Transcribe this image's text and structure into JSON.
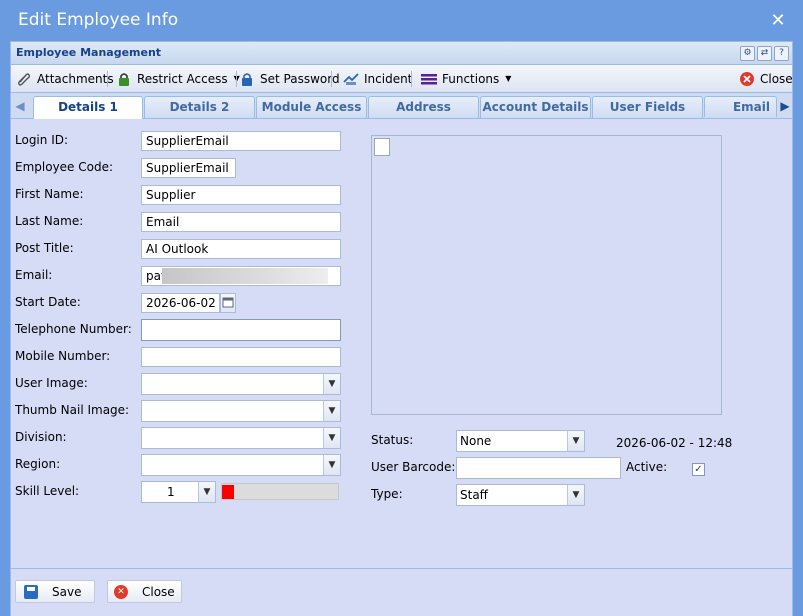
{
  "window": {
    "title": "Edit Employee Info"
  },
  "panel": {
    "title": "Employee Management"
  },
  "toolbar": {
    "attachments": "Attachments",
    "restrict_access": "Restrict Access",
    "set_password": "Set Password",
    "incident": "Incident",
    "functions": "Functions",
    "close": "Close"
  },
  "tabs": [
    "Details 1",
    "Details 2",
    "Module Access",
    "Address",
    "Account Details",
    "User Fields",
    "Email"
  ],
  "form": {
    "login_id": {
      "label": "Login ID:",
      "value": "SupplierEmail"
    },
    "employee_code": {
      "label": "Employee Code:",
      "value": "SupplierEmail"
    },
    "first_name": {
      "label": "First Name:",
      "value": "Supplier"
    },
    "last_name": {
      "label": "Last Name:",
      "value": "Email"
    },
    "post_title": {
      "label": "Post Title:",
      "value": "AI Outlook"
    },
    "email": {
      "label": "Email:",
      "value": "pay"
    },
    "start_date": {
      "label": "Start Date:",
      "value": "2026-06-02"
    },
    "telephone": {
      "label": "Telephone Number:",
      "value": ""
    },
    "mobile": {
      "label": "Mobile Number:",
      "value": ""
    },
    "user_image": {
      "label": "User Image:",
      "value": ""
    },
    "thumb_image": {
      "label": "Thumb Nail Image:",
      "value": ""
    },
    "division": {
      "label": "Division:",
      "value": ""
    },
    "region": {
      "label": "Region:",
      "value": ""
    },
    "skill_level": {
      "label": "Skill Level:",
      "value": "1",
      "fill": 0.1
    }
  },
  "right": {
    "status": {
      "label": "Status:",
      "value": "None"
    },
    "timestamp": "2026-06-02 - 12:48",
    "user_barcode": {
      "label": "User Barcode:",
      "value": ""
    },
    "active": {
      "label": "Active:",
      "checked": true
    },
    "type": {
      "label": "Type:",
      "value": "Staff"
    }
  },
  "footer": {
    "save": "Save",
    "close": "Close"
  },
  "colors": {
    "accent": "#15428b",
    "window": "#6a9be0",
    "panel_bg": "#d6dcf5",
    "skill": "#ff0000"
  }
}
